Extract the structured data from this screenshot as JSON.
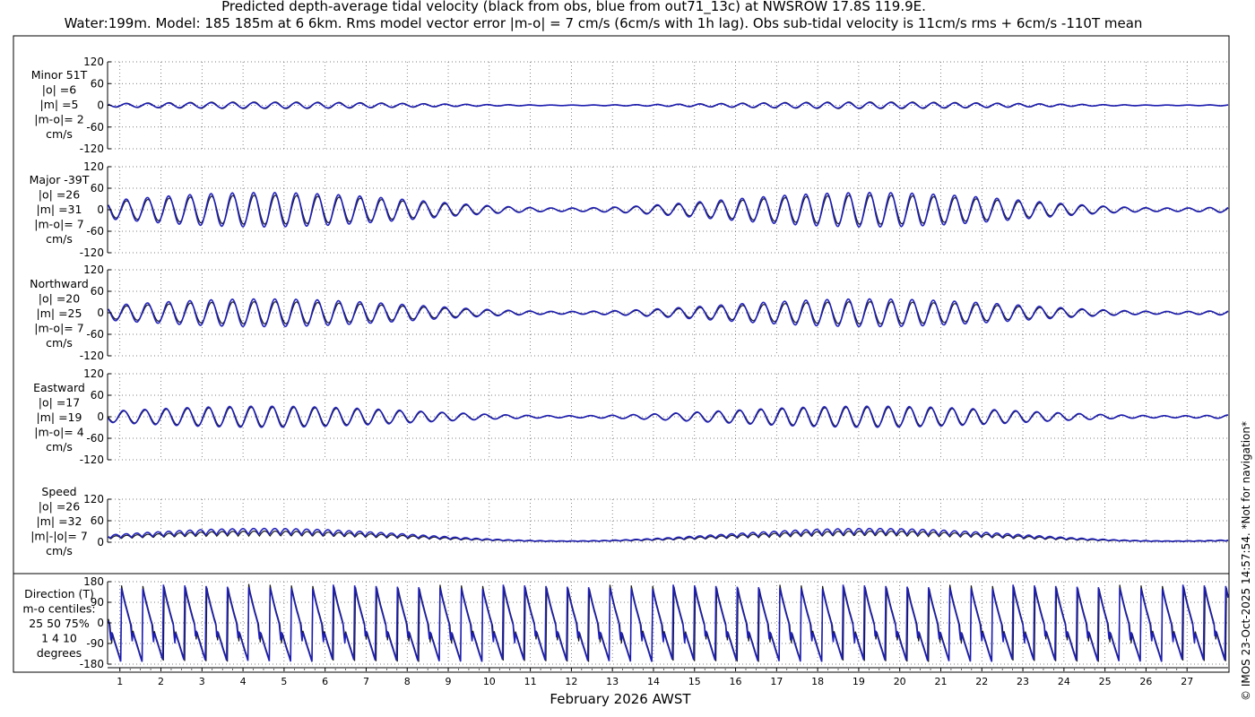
{
  "header": {
    "title_line1": "Predicted depth-average tidal velocity (black from obs, blue from out71_13c) at NWSROW 17.8S 119.9E.",
    "title_line2": "Water:199m. Model: 185 185m at 6 6km. Rms model vector error |m-o| = 7 cm/s (6cm/s with 1h lag). Obs sub-tidal velocity is 11cm/s rms + 6cm/s -110T mean"
  },
  "credit": "© IMOS 23-Oct-2025 14:57:54. *Not for navigation*",
  "xaxis": {
    "label": "February 2026 AWST",
    "ticks": [
      "1",
      "2",
      "3",
      "4",
      "5",
      "6",
      "7",
      "8",
      "9",
      "10",
      "11",
      "12",
      "13",
      "14",
      "15",
      "16",
      "17",
      "18",
      "19",
      "20",
      "21",
      "22",
      "23",
      "24",
      "25",
      "26",
      "27"
    ]
  },
  "colors": {
    "obs": "#000000",
    "model": "#1a1ab8",
    "grid": "#555555"
  },
  "chart_data": [
    {
      "type": "line",
      "name": "minor",
      "panel_label": [
        "Minor 51T",
        "|o| =6",
        "|m| =5",
        "|m-o|= 2",
        "cm/s"
      ],
      "ylim": [
        -120,
        120
      ],
      "yticks": [
        "120",
        "60",
        "0",
        "-60",
        "-120"
      ],
      "series": [
        {
          "name": "obs",
          "amplitude": 6
        },
        {
          "name": "model",
          "amplitude": 5
        }
      ]
    },
    {
      "type": "line",
      "name": "major",
      "panel_label": [
        "Major -39T",
        "|o| =26",
        "|m| =31",
        "|m-o|= 7",
        "cm/s"
      ],
      "ylim": [
        -120,
        120
      ],
      "yticks": [
        "120",
        "60",
        "0",
        "-60",
        "-120"
      ],
      "series": [
        {
          "name": "obs",
          "amplitude": 26
        },
        {
          "name": "model",
          "amplitude": 31
        }
      ]
    },
    {
      "type": "line",
      "name": "northward",
      "panel_label": [
        "Northward",
        "|o| =20",
        "|m| =25",
        "|m-o|= 7",
        "cm/s"
      ],
      "ylim": [
        -120,
        120
      ],
      "yticks": [
        "120",
        "60",
        "0",
        "-60",
        "-120"
      ],
      "series": [
        {
          "name": "obs",
          "amplitude": 20
        },
        {
          "name": "model",
          "amplitude": 25
        }
      ]
    },
    {
      "type": "line",
      "name": "eastward",
      "panel_label": [
        "Eastward",
        "|o| =17",
        "|m| =19",
        "|m-o|= 4",
        "cm/s"
      ],
      "ylim": [
        -120,
        120
      ],
      "yticks": [
        "120",
        "60",
        "0",
        "-60",
        "-120"
      ],
      "series": [
        {
          "name": "obs",
          "amplitude": 17
        },
        {
          "name": "model",
          "amplitude": 19
        }
      ]
    },
    {
      "type": "line",
      "name": "speed",
      "panel_label": [
        "Speed",
        "|o| =26",
        "|m| =32",
        "|m|-|o|= 7",
        "cm/s"
      ],
      "ylim": [
        0,
        120
      ],
      "yticks": [
        "120",
        "60",
        "0"
      ],
      "series": [
        {
          "name": "obs",
          "amplitude": 26
        },
        {
          "name": "model",
          "amplitude": 32
        }
      ]
    },
    {
      "type": "line",
      "name": "direction",
      "panel_label": [
        "Direction (T)",
        "m-o centiles:",
        "25  50  75%",
        "1   4  10",
        "degrees"
      ],
      "ylim": [
        -180,
        180
      ],
      "yticks": [
        "180",
        "90",
        "0",
        "-90",
        "-180"
      ],
      "series": [
        {
          "name": "obs"
        },
        {
          "name": "model"
        }
      ]
    }
  ]
}
